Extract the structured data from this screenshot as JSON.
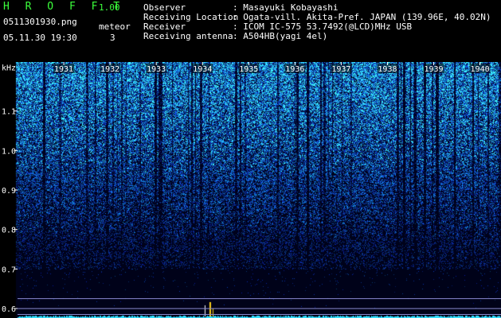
{
  "header": {
    "app_title": "H R O F F T",
    "version": "1.00",
    "filename": "0511301930.png",
    "timestamp": "05.11.30 19:30",
    "meteor_label": "meteor",
    "meteor_count": "3",
    "info_labels": [
      "Observer",
      "Receiving Location",
      "Receiver",
      "Receiving antenna"
    ],
    "info_values": [
      ": Masayuki Kobayashi",
      ": Ogata-vill. Akita-Pref. JAPAN (139.96E, 40.02N)",
      ": ICOM IC-575 53.7492(@LCD)MHz USB",
      ": A504HB(yagi 4el)"
    ]
  },
  "chart_data": {
    "type": "heatmap",
    "yunit": "kHz",
    "y_ticks": [
      "1.1",
      "1.0",
      "0.9",
      "0.8",
      "0.7",
      "0.6"
    ],
    "y_tick_values": [
      1.1,
      1.0,
      0.9,
      0.8,
      0.7,
      0.6
    ],
    "ylim": [
      0.58,
      1.22
    ],
    "x_ticks": [
      "1931",
      "1932",
      "1933",
      "1934",
      "1935",
      "1936",
      "1937",
      "1938",
      "1939",
      "1940"
    ],
    "xlim": [
      1930,
      1940.3
    ],
    "colors": {
      "background": "#000000",
      "low": "#0b1a6e",
      "mid": "#1f5fe0",
      "high": "#33e0ff",
      "label": "#3cff3c"
    }
  }
}
